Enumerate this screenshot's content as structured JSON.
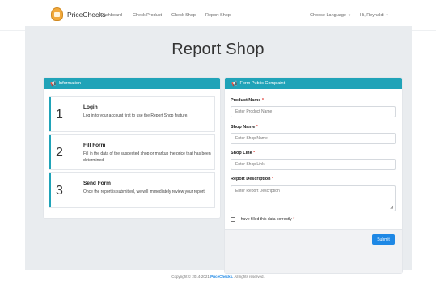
{
  "nav": {
    "brand": "PriceChecks",
    "links": [
      "Dashboard",
      "Check Product",
      "Check Shop",
      "Report Shop"
    ],
    "language": "Choose Language",
    "user": "Hi, Reynaldi"
  },
  "page": {
    "title": "Report Shop"
  },
  "info": {
    "header": "Information",
    "steps": [
      {
        "number": "1",
        "title": "Login",
        "desc": "Log in to your account first to use the Report Shop feature."
      },
      {
        "number": "2",
        "title": "Fill Form",
        "desc": "Fill in the data of the suspected shop or markup the price that has been determined."
      },
      {
        "number": "3",
        "title": "Send Form",
        "desc": "Once the report is submitted, we will immediately review your report."
      }
    ]
  },
  "form": {
    "header": "Form Public Complaint",
    "product_name": {
      "label": "Product Name",
      "placeholder": "Enter Product Name"
    },
    "shop_name": {
      "label": "Shop Name",
      "placeholder": "Enter Shop Name"
    },
    "shop_link": {
      "label": "Shop Link",
      "placeholder": "Enter Shop Link"
    },
    "report_desc": {
      "label": "Report Description",
      "placeholder": "Enter Report Description"
    },
    "required_mark": "*",
    "checkbox_label": "I have filled this data correctly",
    "submit": "Submit"
  },
  "footer": {
    "prefix": "Copyright © 2014-2021",
    "brand": "PriceChecks.",
    "suffix": "All rights reserved."
  },
  "colors": {
    "accent": "#20a3b8",
    "primary": "#1e88e5",
    "required": "#e0403a"
  },
  "icons": {
    "brand": "pricechecks-logo-icon",
    "header": "megaphone-icon",
    "caret": "caret-down-icon"
  }
}
